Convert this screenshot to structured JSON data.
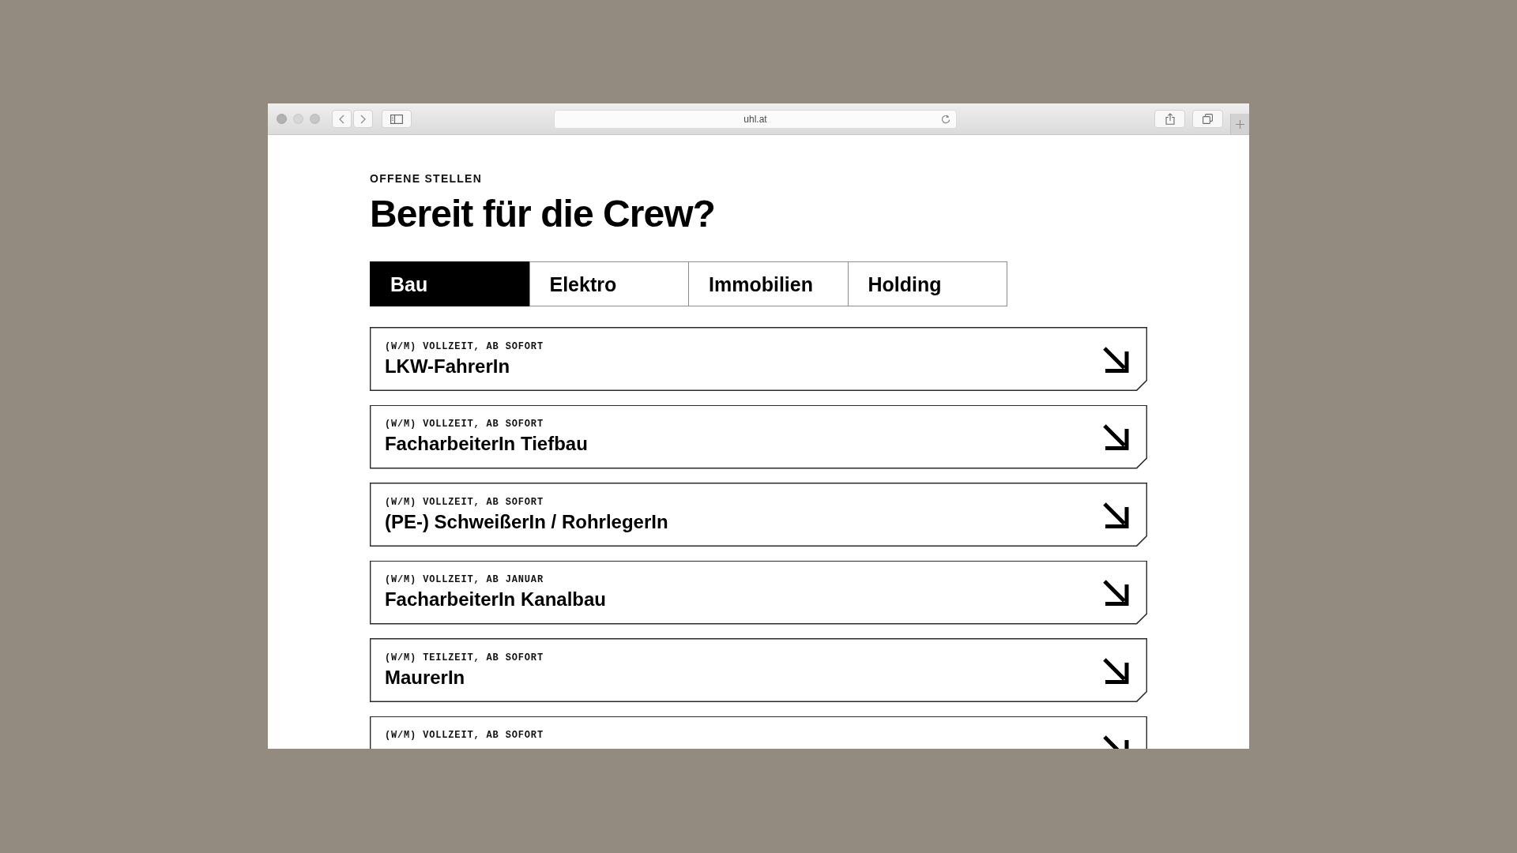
{
  "browser": {
    "url": "uhl.at"
  },
  "eyebrow": "OFFENE STELLEN",
  "heading": "Bereit für die Crew?",
  "tabs": [
    {
      "label": "Bau",
      "selected": true
    },
    {
      "label": "Elektro",
      "selected": false
    },
    {
      "label": "Immobilien",
      "selected": false
    },
    {
      "label": "Holding",
      "selected": false
    }
  ],
  "jobs": [
    {
      "meta": "(W/M) VOLLZEIT, AB SOFORT",
      "title": "LKW-FahrerIn"
    },
    {
      "meta": "(W/M) VOLLZEIT, AB SOFORT",
      "title": "FacharbeiterIn Tiefbau"
    },
    {
      "meta": "(W/M) VOLLZEIT, AB SOFORT",
      "title": "(PE-) SchweißerIn / RohrlegerIn"
    },
    {
      "meta": "(W/M) VOLLZEIT, AB JANUAR",
      "title": "FacharbeiterIn Kanalbau"
    },
    {
      "meta": "(W/M) TEILZEIT, AB SOFORT",
      "title": "MaurerIn"
    },
    {
      "meta": "(W/M) VOLLZEIT, AB SOFORT"
    }
  ]
}
